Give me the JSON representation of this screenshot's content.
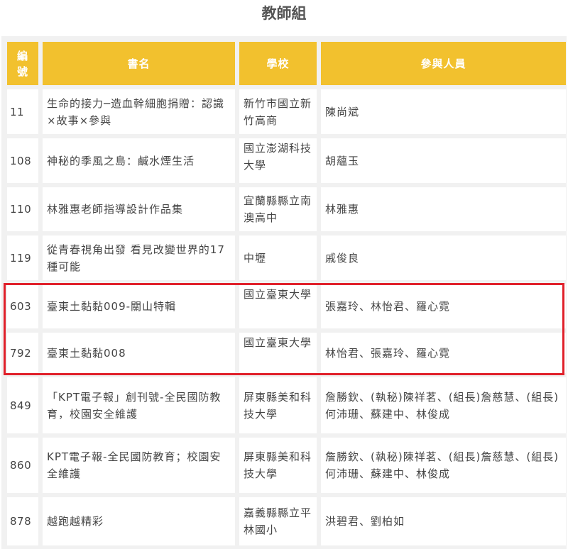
{
  "title": "教師組",
  "headers": {
    "num_line1": "編",
    "num_line2": "號",
    "book": "書名",
    "school": "學校",
    "members": "參與人員"
  },
  "rows": [
    {
      "num": "11",
      "book": "生命的接力─造血幹細胞捐贈：認識×故事×參與",
      "school": "新竹市國立新竹高商",
      "members": "陳尚斌"
    },
    {
      "num": "108",
      "book": "神秘的季風之島：鹹水煙生活",
      "school": "國立澎湖科技大學",
      "members": "胡蘊玉"
    },
    {
      "num": "110",
      "book": "林雅惠老師指導設計作品集",
      "school": "宜蘭縣縣立南澳高中",
      "members": "林雅惠"
    },
    {
      "num": "119",
      "book": "從青春視角出發 看見改變世界的17種可能",
      "school": "中壢",
      "members": "戚俊良"
    },
    {
      "num": "603",
      "book": "臺東土黏黏009-關山特輯",
      "school": "國立臺東大學",
      "members": "張嘉玲、林怡君、羅心霓"
    },
    {
      "num": "792",
      "book": "臺東土黏黏008",
      "school": "國立臺東大學",
      "members": "林怡君、張嘉玲、羅心霓"
    },
    {
      "num": "849",
      "book": "「KPT電子報」創刊號-全民國防教育，校園安全維護",
      "school": "屏東縣美和科技大學",
      "members": "詹勝欽、(執秘)陳祥茗、(組長)詹慈慧、(組長)何沛珊、蘇建中、林俊成"
    },
    {
      "num": "860",
      "book": "KPT電子報-全民國防教育；校園安全維護",
      "school": "屏東縣美和科技大學",
      "members": "詹勝欽、(執秘)陳祥茗、(組長)詹慈慧、(組長)何沛珊、蘇建中、林俊成"
    },
    {
      "num": "878",
      "book": "越跑越精彩",
      "school": "嘉義縣縣立平林國小",
      "members": "洪碧君、劉柏如"
    }
  ],
  "colors": {
    "header_bg": "#f2c12e",
    "highlight_border": "#e0202a"
  }
}
